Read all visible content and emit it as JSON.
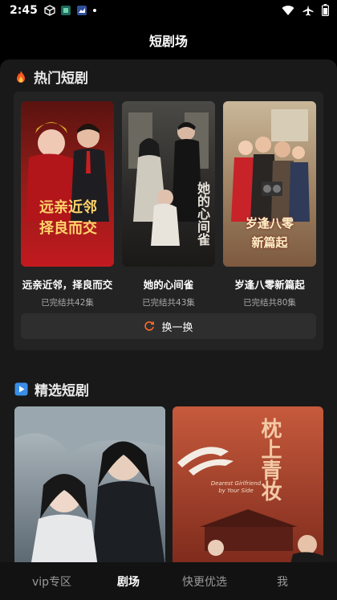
{
  "status_bar": {
    "time": "2:45"
  },
  "app": {
    "title": "短剧场"
  },
  "hot_section": {
    "icon": "fire-icon",
    "title": "热门短剧",
    "dramas": [
      {
        "title": "远亲近邻，择良而交",
        "episodes": "已完结共42集",
        "poster_text": "远亲近邻\n择良而交",
        "accent": "#c21a1f"
      },
      {
        "title": "她的心间雀",
        "episodes": "已完结共43集",
        "poster_text": "她的心间雀",
        "accent": "#3a3a3a"
      },
      {
        "title": "岁逢八零新篇起",
        "episodes": "已完结共80集",
        "poster_text": "岁逢八零\n新篇起",
        "accent": "#d84a2c"
      }
    ],
    "swap_label": "换一换"
  },
  "featured_section": {
    "icon": "play-icon",
    "title": "精选短剧",
    "posters": [
      {
        "poster_text": ""
      },
      {
        "poster_text": "枕上青妆",
        "subtitle": "Dearest Girlfriend by Your Side"
      }
    ]
  },
  "bottom_nav": {
    "items": [
      {
        "label": "vip专区",
        "active": false
      },
      {
        "label": "剧场",
        "active": true
      },
      {
        "label": "快更优选",
        "active": false
      },
      {
        "label": "我",
        "active": false
      }
    ]
  }
}
